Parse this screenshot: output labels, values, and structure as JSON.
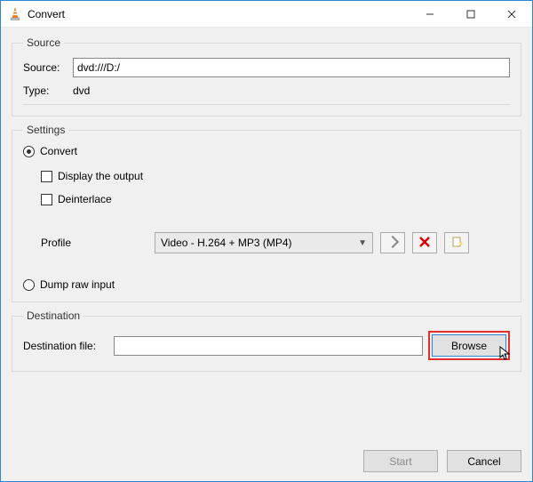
{
  "window": {
    "title": "Convert"
  },
  "source": {
    "legend": "Source",
    "source_label": "Source:",
    "source_value": "dvd:///D:/",
    "type_label": "Type:",
    "type_value": "dvd"
  },
  "settings": {
    "legend": "Settings",
    "convert_label": "Convert",
    "display_label": "Display the output",
    "deinterlace_label": "Deinterlace",
    "profile_label": "Profile",
    "profile_value": "Video - H.264 + MP3 (MP4)",
    "dump_label": "Dump raw input"
  },
  "destination": {
    "legend": "Destination",
    "file_label": "Destination file:",
    "file_value": "",
    "browse_label": "Browse"
  },
  "footer": {
    "start_label": "Start",
    "cancel_label": "Cancel"
  }
}
